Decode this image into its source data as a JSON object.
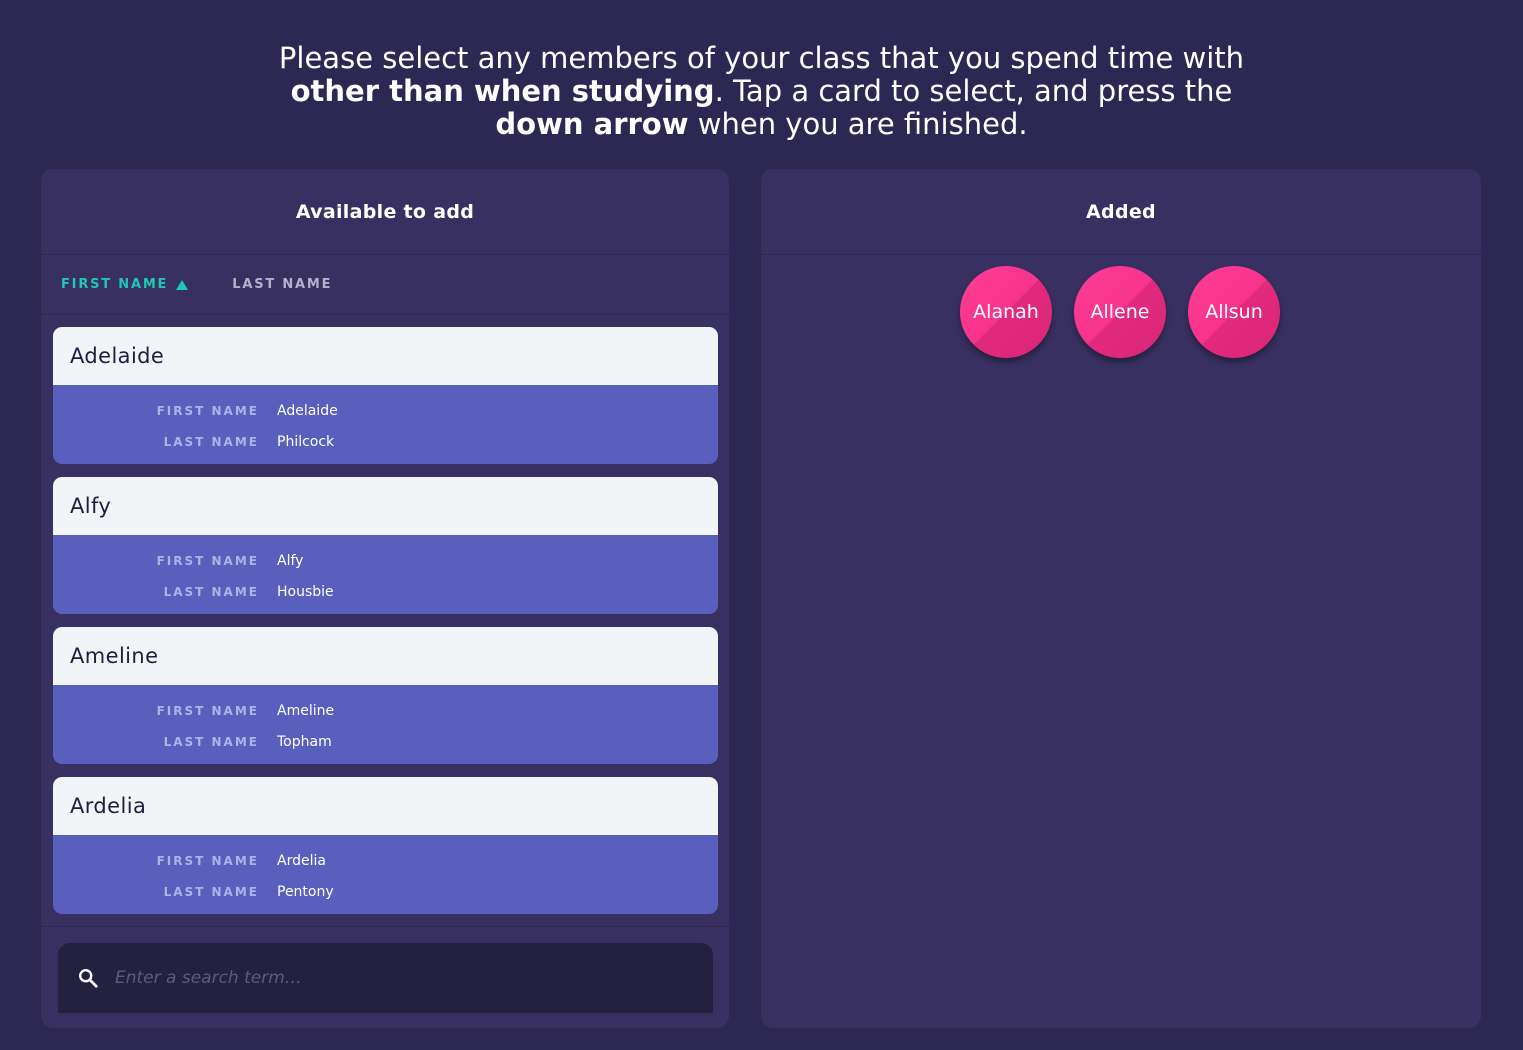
{
  "instructions": {
    "part1": "Please select any members of your class that you spend time with ",
    "bold1": "other than when studying",
    "part2": ". Tap a card to select, and press the ",
    "bold2": "down arrow",
    "part3": " when you are finished."
  },
  "available": {
    "title": "Available to add",
    "sort": {
      "first_name_label": "FIRST NAME",
      "last_name_label": "LAST NAME",
      "active": "first_name",
      "direction": "ascending"
    },
    "labels": {
      "first_name": "FIRST NAME",
      "last_name": "LAST NAME"
    },
    "cards": [
      {
        "title": "Adelaide",
        "first_name": "Adelaide",
        "last_name": "Philcock"
      },
      {
        "title": "Alfy",
        "first_name": "Alfy",
        "last_name": "Housbie"
      },
      {
        "title": "Ameline",
        "first_name": "Ameline",
        "last_name": "Topham"
      },
      {
        "title": "Ardelia",
        "first_name": "Ardelia",
        "last_name": "Pentony"
      }
    ],
    "search": {
      "placeholder": "Enter a search term…",
      "value": ""
    }
  },
  "added": {
    "title": "Added",
    "members": [
      "Alanah",
      "Allene",
      "Allsun"
    ]
  },
  "colors": {
    "background": "#2c2753",
    "panel": "#373060",
    "accent": "#1fc7b4",
    "card_body": "#585fbd",
    "bubble": "#f7338b"
  }
}
